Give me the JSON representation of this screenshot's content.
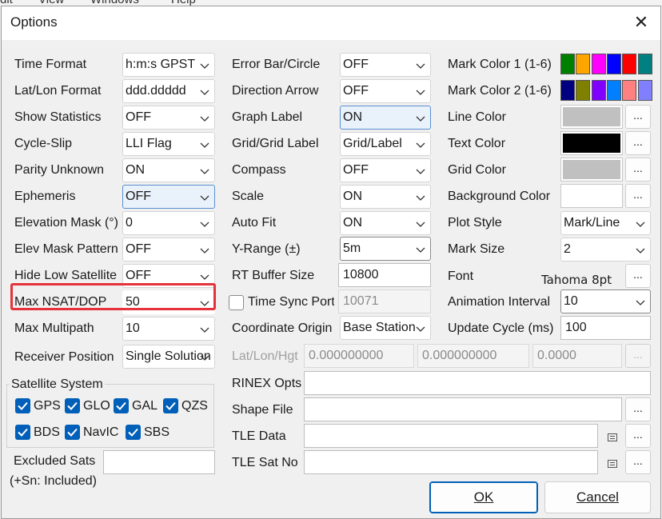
{
  "app_menubar": {
    "items": [
      "dit",
      "View",
      "Windows",
      "Help"
    ]
  },
  "dialog": {
    "title": "Options",
    "close_glyph": "✕"
  },
  "left": {
    "time_format": {
      "label": "Time Format",
      "value": "h:m:s GPST"
    },
    "latlon_format": {
      "label": "Lat/Lon Format",
      "value": "ddd.ddddd"
    },
    "show_statistics": {
      "label": "Show Statistics",
      "value": "OFF"
    },
    "cycle_slip": {
      "label": "Cycle-Slip",
      "value": "LLI Flag"
    },
    "parity_unknown": {
      "label": "Parity Unknown",
      "value": "ON"
    },
    "ephemeris": {
      "label": "Ephemeris",
      "value": "OFF"
    },
    "elevation_mask": {
      "label": "Elevation Mask (°)",
      "value": "0"
    },
    "elev_mask_pattern": {
      "label": "Elev Mask Pattern",
      "value": "OFF"
    },
    "hide_low_satellite": {
      "label": "Hide Low Satellite",
      "value": "OFF"
    },
    "max_nsat_dop": {
      "label": "Max NSAT/DOP",
      "value": "50"
    },
    "max_multipath": {
      "label": "Max Multipath",
      "value": "10"
    },
    "receiver_position": {
      "label": "Receiver Position",
      "value": "Single Solution"
    },
    "satellite_system": {
      "label": "Satellite System",
      "items": [
        {
          "label": "GPS",
          "checked": true
        },
        {
          "label": "GLO",
          "checked": true
        },
        {
          "label": "GAL",
          "checked": true
        },
        {
          "label": "QZS",
          "checked": true
        },
        {
          "label": "BDS",
          "checked": true
        },
        {
          "label": "NavIC",
          "checked": true
        },
        {
          "label": "SBS",
          "checked": true
        }
      ]
    },
    "excluded_sats": {
      "label": "Excluded Sats",
      "note": "(+Sn: Included)",
      "value": ""
    }
  },
  "middle": {
    "error_bar": {
      "label": "Error Bar/Circle",
      "value": "OFF"
    },
    "direction_arrow": {
      "label": "Direction Arrow",
      "value": "OFF"
    },
    "graph_label": {
      "label": "Graph Label",
      "value": "ON"
    },
    "grid_label": {
      "label": "Grid/Grid Label",
      "value": "Grid/Label"
    },
    "compass": {
      "label": "Compass",
      "value": "OFF"
    },
    "scale": {
      "label": "Scale",
      "value": "ON"
    },
    "auto_fit": {
      "label": "Auto Fit",
      "value": "ON"
    },
    "y_range": {
      "label": "Y-Range (±)",
      "value": "5m"
    },
    "rt_buffer": {
      "label": "RT Buffer Size",
      "value": "10800"
    },
    "time_sync": {
      "label": "Time Sync Port",
      "value": "10071",
      "checked": false
    },
    "coord_origin": {
      "label": "Coordinate Origin",
      "value": "Base Station"
    },
    "latlonhgt": {
      "label": "Lat/Lon/Hgt",
      "lat": "0.000000000",
      "lon": "0.000000000",
      "hgt": "0.0000"
    },
    "rinex_opts": {
      "label": "RINEX Opts",
      "value": ""
    },
    "shape_file": {
      "label": "Shape File",
      "value": ""
    },
    "tle_data": {
      "label": "TLE Data",
      "value": ""
    },
    "tle_sat_no": {
      "label": "TLE Sat No",
      "value": ""
    }
  },
  "right": {
    "mark_color_1": {
      "label": "Mark Color 1 (1-6)",
      "colors": [
        "#008000",
        "#ffa500",
        "#ff00ff",
        "#0000ff",
        "#ff0000",
        "#008080"
      ]
    },
    "mark_color_2": {
      "label": "Mark Color 2 (1-6)",
      "colors": [
        "#000080",
        "#808000",
        "#8000ff",
        "#0080ff",
        "#ff8080",
        "#8080ff"
      ]
    },
    "line_color": {
      "label": "Line Color",
      "color": "#c0c0c0"
    },
    "text_color": {
      "label": "Text Color",
      "color": "#000000"
    },
    "grid_color": {
      "label": "Grid Color",
      "color": "#c0c0c0"
    },
    "background_color": {
      "label": "Background Color",
      "color": "#ffffff"
    },
    "plot_style": {
      "label": "Plot Style",
      "value": "Mark/Line"
    },
    "mark_size": {
      "label": "Mark Size",
      "value": "2"
    },
    "font": {
      "label": "Font",
      "value": "Tahoma 8pt"
    },
    "animation_interval": {
      "label": "Animation Interval",
      "value": "10"
    },
    "update_cycle": {
      "label": "Update Cycle (ms)",
      "value": "100"
    }
  },
  "buttons": {
    "ellipsis": "...",
    "ok": "OK",
    "cancel": "Cancel"
  },
  "colors": {
    "accent": "#005fb8",
    "highlight_frame": "#e5323b"
  }
}
